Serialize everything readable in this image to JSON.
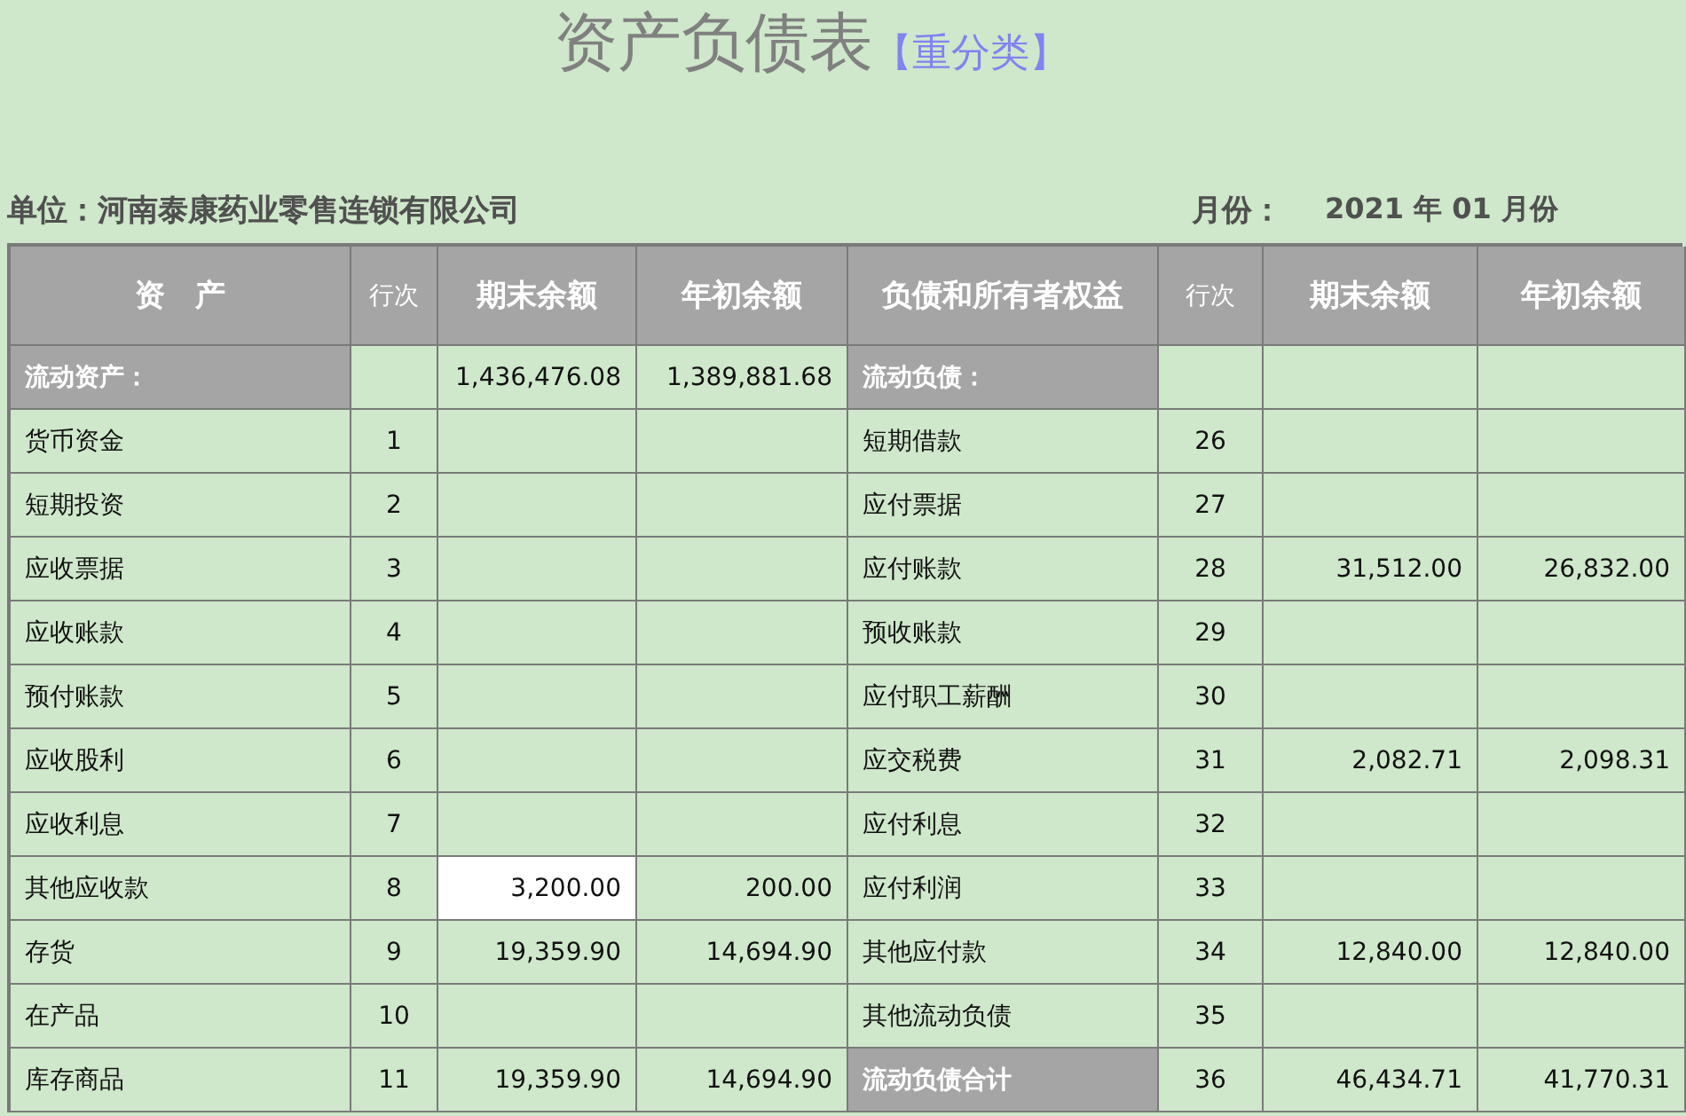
{
  "title": "资产负债表",
  "subtitle": "【重分类】",
  "unit": {
    "label": "单位：",
    "value": "河南泰康药业零售连锁有限公司"
  },
  "period": {
    "label": "月份：",
    "value": "2021 年 01 月份"
  },
  "columns": [
    {
      "label": "资　产",
      "kind": "main"
    },
    {
      "label": "行次",
      "kind": "small"
    },
    {
      "label": "期末余额",
      "kind": "main"
    },
    {
      "label": "年初余额",
      "kind": "main"
    },
    {
      "label": "负债和所有者权益",
      "kind": "main"
    },
    {
      "label": "行次",
      "kind": "small"
    },
    {
      "label": "期末余额",
      "kind": "main"
    },
    {
      "label": "年初余额",
      "kind": "main"
    }
  ],
  "rows": [
    [
      {
        "text": "流动资产：",
        "kind": "heading",
        "selected": false
      },
      {
        "selected": false
      },
      {
        "text": "1,436,476.08",
        "selected": false
      },
      {
        "text": "1,389,881.68",
        "selected": false
      },
      {
        "text": "流动负债：",
        "kind": "heading",
        "selected": false
      },
      {
        "selected": false
      },
      {
        "selected": false
      },
      {
        "selected": false
      }
    ],
    [
      {
        "text": "货币资金",
        "selected": false
      },
      {
        "text": "1",
        "selected": false
      },
      {
        "selected": false
      },
      {
        "selected": false
      },
      {
        "text": "短期借款",
        "selected": false
      },
      {
        "text": "26",
        "selected": false
      },
      {
        "selected": false
      },
      {
        "selected": false
      }
    ],
    [
      {
        "text": "短期投资",
        "selected": false
      },
      {
        "text": "2",
        "selected": false
      },
      {
        "selected": false
      },
      {
        "selected": false
      },
      {
        "text": "应付票据",
        "selected": false
      },
      {
        "text": "27",
        "selected": false
      },
      {
        "selected": false
      },
      {
        "selected": false
      }
    ],
    [
      {
        "text": "应收票据",
        "selected": false
      },
      {
        "text": "3",
        "selected": false
      },
      {
        "selected": false
      },
      {
        "selected": false
      },
      {
        "text": "应付账款",
        "selected": false
      },
      {
        "text": "28",
        "selected": false
      },
      {
        "text": "31,512.00",
        "selected": false
      },
      {
        "text": "26,832.00",
        "selected": false
      }
    ],
    [
      {
        "text": "应收账款",
        "selected": false
      },
      {
        "text": "4",
        "selected": false
      },
      {
        "selected": false
      },
      {
        "selected": false
      },
      {
        "text": "预收账款",
        "selected": false
      },
      {
        "text": "29",
        "selected": false
      },
      {
        "selected": false
      },
      {
        "selected": false
      }
    ],
    [
      {
        "text": "预付账款",
        "selected": false
      },
      {
        "text": "5",
        "selected": false
      },
      {
        "selected": false
      },
      {
        "selected": false
      },
      {
        "text": "应付职工薪酬",
        "selected": false
      },
      {
        "text": "30",
        "selected": false
      },
      {
        "selected": false
      },
      {
        "selected": false
      }
    ],
    [
      {
        "text": "应收股利",
        "selected": false
      },
      {
        "text": "6",
        "selected": false
      },
      {
        "selected": false
      },
      {
        "selected": false
      },
      {
        "text": "应交税费",
        "selected": false
      },
      {
        "text": "31",
        "selected": false
      },
      {
        "text": "2,082.71",
        "selected": false
      },
      {
        "text": "2,098.31",
        "selected": false
      }
    ],
    [
      {
        "text": "应收利息",
        "selected": false
      },
      {
        "text": "7",
        "selected": false
      },
      {
        "selected": false
      },
      {
        "selected": false
      },
      {
        "text": "应付利息",
        "selected": false
      },
      {
        "text": "32",
        "selected": false
      },
      {
        "selected": false
      },
      {
        "selected": false
      }
    ],
    [
      {
        "text": "其他应收款",
        "selected": false
      },
      {
        "text": "8",
        "selected": false
      },
      {
        "text": "3,200.00",
        "selected": true
      },
      {
        "text": "200.00",
        "selected": false
      },
      {
        "text": "应付利润",
        "selected": false
      },
      {
        "text": "33",
        "selected": false
      },
      {
        "selected": false
      },
      {
        "selected": false
      }
    ],
    [
      {
        "text": "存货",
        "selected": false
      },
      {
        "text": "9",
        "selected": false
      },
      {
        "text": "19,359.90",
        "selected": false
      },
      {
        "text": "14,694.90",
        "selected": false
      },
      {
        "text": "其他应付款",
        "selected": false
      },
      {
        "text": "34",
        "selected": false
      },
      {
        "text": "12,840.00",
        "selected": false
      },
      {
        "text": "12,840.00",
        "selected": false
      }
    ],
    [
      {
        "text": "在产品",
        "selected": false
      },
      {
        "text": "10",
        "selected": false
      },
      {
        "selected": false
      },
      {
        "selected": false
      },
      {
        "text": "其他流动负债",
        "selected": false
      },
      {
        "text": "35",
        "selected": false
      },
      {
        "selected": false
      },
      {
        "selected": false
      }
    ],
    [
      {
        "text": "库存商品",
        "selected": false
      },
      {
        "text": "11",
        "selected": false
      },
      {
        "text": "19,359.90",
        "selected": false
      },
      {
        "text": "14,694.90",
        "selected": false
      },
      {
        "text": "流动负债合计",
        "kind": "heading",
        "selected": false
      },
      {
        "text": "36",
        "selected": false
      },
      {
        "text": "46,434.71",
        "selected": false
      },
      {
        "text": "41,770.31",
        "selected": false
      }
    ]
  ]
}
